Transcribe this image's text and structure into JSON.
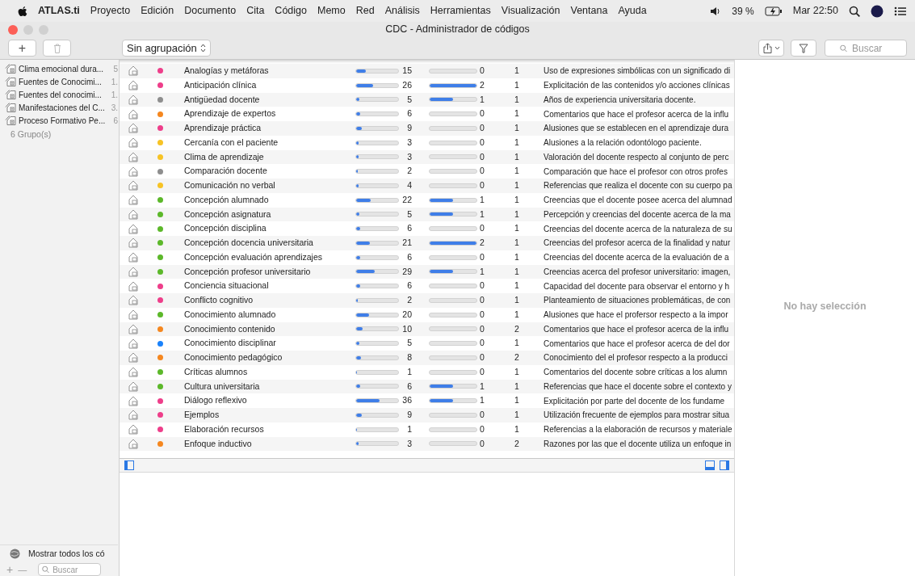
{
  "menubar": {
    "app": "ATLAS.ti",
    "menus": [
      "Proyecto",
      "Edición",
      "Documento",
      "Cita",
      "Código",
      "Memo",
      "Red",
      "Análisis",
      "Herramientas",
      "Visualización",
      "Ventana",
      "Ayuda"
    ],
    "battery": "39 %",
    "clock": "Mar 22:50"
  },
  "window": {
    "title": "CDC - Administrador de códigos"
  },
  "toolbar": {
    "add": "+",
    "grouping": "Sin agrupación",
    "search": {
      "placeholder": "Buscar"
    }
  },
  "sidebar": {
    "groups": [
      {
        "name": "Clima emocional dura...",
        "count": "5"
      },
      {
        "name": "Fuentes de Conocimi...",
        "count": "1."
      },
      {
        "name": "Fuentes del conocimi...",
        "count": "1."
      },
      {
        "name": "Manifestaciones del C...",
        "count": "3."
      },
      {
        "name": "Proceso Formativo Pe...",
        "count": "6"
      }
    ],
    "summary": "6 Grupo(s)",
    "show_all": "Mostrar todos los có",
    "add": "+",
    "remove": "—",
    "search": {
      "placeholder": "Buscar"
    }
  },
  "table": {
    "rows": [
      {
        "name": "Analogías y metáforas",
        "color": "#ee3e8a",
        "quotations": {
          "count": "15",
          "level": 0.23
        },
        "links": {
          "count": "0",
          "level": 0
        },
        "column_3": "1",
        "comment": "Uso de expresiones simbólicas con un significado di"
      },
      {
        "name": "Anticipación clínica",
        "color": "#ee3e8a",
        "quotations": {
          "count": "26",
          "level": 0.4
        },
        "links": {
          "count": "2",
          "level": 1
        },
        "column_3": "1",
        "comment": "Explicitación de las contenidos y/o acciones clínicas"
      },
      {
        "name": "Antigüedad docente",
        "color": "#8e8e8e",
        "quotations": {
          "count": "5",
          "level": 0.08
        },
        "links": {
          "count": "1",
          "level": 0.5
        },
        "column_3": "1",
        "comment": "Años de experiencia universitaria docente."
      },
      {
        "name": "Aprendizaje de expertos",
        "color": "#f5871f",
        "quotations": {
          "count": "6",
          "level": 0.09
        },
        "links": {
          "count": "0",
          "level": 0
        },
        "column_3": "1",
        "comment": "Comentarios que hace el profesor acerca  de la influ"
      },
      {
        "name": "Aprendizaje práctica",
        "color": "#ee3e8a",
        "quotations": {
          "count": "9",
          "level": 0.14
        },
        "links": {
          "count": "0",
          "level": 0
        },
        "column_3": "1",
        "comment": "Alusiones que se establecen en el aprendizaje dura"
      },
      {
        "name": "Cercanía con el paciente",
        "color": "#f7c325",
        "quotations": {
          "count": "3",
          "level": 0.05
        },
        "links": {
          "count": "0",
          "level": 0
        },
        "column_3": "1",
        "comment": "Alusiones a la relación odontólogo paciente."
      },
      {
        "name": "Clima de aprendizaje",
        "color": "#f7c325",
        "quotations": {
          "count": "3",
          "level": 0.05
        },
        "links": {
          "count": "0",
          "level": 0
        },
        "column_3": "1",
        "comment": "Valoración del docente respecto al conjunto de perc"
      },
      {
        "name": "Comparación docente",
        "color": "#8e8e8e",
        "quotations": {
          "count": "2",
          "level": 0.03
        },
        "links": {
          "count": "0",
          "level": 0
        },
        "column_3": "1",
        "comment": "Comparación que hace el profesor con otros profes"
      },
      {
        "name": "Comunicación no verbal",
        "color": "#f7c325",
        "quotations": {
          "count": "4",
          "level": 0.06
        },
        "links": {
          "count": "0",
          "level": 0
        },
        "column_3": "1",
        "comment": "Referencias que realiza el docente con su cuerpo pa"
      },
      {
        "name": "Concepción alumnado",
        "color": "#5cb82a",
        "quotations": {
          "count": "22",
          "level": 0.34
        },
        "links": {
          "count": "1",
          "level": 0.5
        },
        "column_3": "1",
        "comment": "Creencias que el docente posee acerca del alumnad"
      },
      {
        "name": "Concepción asignatura",
        "color": "#5cb82a",
        "quotations": {
          "count": "5",
          "level": 0.08
        },
        "links": {
          "count": "1",
          "level": 0.5
        },
        "column_3": "1",
        "comment": "Percepción y creencias del docente acerca de la ma"
      },
      {
        "name": "Concepción disciplina",
        "color": "#5cb82a",
        "quotations": {
          "count": "6",
          "level": 0.09
        },
        "links": {
          "count": "0",
          "level": 0
        },
        "column_3": "1",
        "comment": "Creencias del docente acerca de la naturaleza de su"
      },
      {
        "name": "Concepción docencia universitaria",
        "color": "#5cb82a",
        "quotations": {
          "count": "21",
          "level": 0.32
        },
        "links": {
          "count": "2",
          "level": 1
        },
        "column_3": "1",
        "comment": "Creencias del profesor acerca de la finalidad y natur"
      },
      {
        "name": "Concepción evaluación aprendizajes",
        "color": "#5cb82a",
        "quotations": {
          "count": "6",
          "level": 0.09
        },
        "links": {
          "count": "0",
          "level": 0
        },
        "column_3": "1",
        "comment": "Creencias del docente acerca de la evaluación de a"
      },
      {
        "name": "Concepción profesor universitario",
        "color": "#5cb82a",
        "quotations": {
          "count": "29",
          "level": 0.45
        },
        "links": {
          "count": "1",
          "level": 0.5
        },
        "column_3": "1",
        "comment": "Creencias acerca del profesor universitario: imagen,"
      },
      {
        "name": "Conciencia situacional",
        "color": "#ee3e8a",
        "quotations": {
          "count": "6",
          "level": 0.09
        },
        "links": {
          "count": "0",
          "level": 0
        },
        "column_3": "1",
        "comment": "Capacidad del docente para observar el entorno y h"
      },
      {
        "name": "Conflicto cognitivo",
        "color": "#ee3e8a",
        "quotations": {
          "count": "2",
          "level": 0.03
        },
        "links": {
          "count": "0",
          "level": 0
        },
        "column_3": "1",
        "comment": "Planteamiento de situaciones problemáticas, de con"
      },
      {
        "name": "Conocimiento alumnado",
        "color": "#5cb82a",
        "quotations": {
          "count": "20",
          "level": 0.3
        },
        "links": {
          "count": "0",
          "level": 0
        },
        "column_3": "1",
        "comment": "Alusiones que hace el profersor respecto a la impor"
      },
      {
        "name": "Conocimiento contenido",
        "color": "#f5871f",
        "quotations": {
          "count": "10",
          "level": 0.15
        },
        "links": {
          "count": "0",
          "level": 0
        },
        "column_3": "2",
        "comment": "Comentarios que hace el profesor acerca de la influ"
      },
      {
        "name": "Conocimiento disciplinar",
        "color": "#1a82fb",
        "quotations": {
          "count": "5",
          "level": 0.08
        },
        "links": {
          "count": "0",
          "level": 0
        },
        "column_3": "1",
        "comment": "Comentarios que hace el profesor acerca de del dor"
      },
      {
        "name": "Conocimiento pedagógico",
        "color": "#f5871f",
        "quotations": {
          "count": "8",
          "level": 0.12
        },
        "links": {
          "count": "0",
          "level": 0
        },
        "column_3": "2",
        "comment": "Conocimiento del el profesor respecto a la producci"
      },
      {
        "name": "Críticas alumnos",
        "color": "#5cb82a",
        "quotations": {
          "count": "1",
          "level": 0.01
        },
        "links": {
          "count": "0",
          "level": 0
        },
        "column_3": "1",
        "comment": "Comentarios del docente sobre críticas a los alumn"
      },
      {
        "name": "Cultura universitaria",
        "color": "#5cb82a",
        "quotations": {
          "count": "6",
          "level": 0.09
        },
        "links": {
          "count": "1",
          "level": 0.5
        },
        "column_3": "1",
        "comment": "Referencias que hace el docente sobre el contexto y"
      },
      {
        "name": "Diálogo reflexivo",
        "color": "#ee3e8a",
        "quotations": {
          "count": "36",
          "level": 0.55
        },
        "links": {
          "count": "1",
          "level": 0.5
        },
        "column_3": "1",
        "comment": "Explicitación por parte del docente de los  fundame"
      },
      {
        "name": "Ejemplos",
        "color": "#ee3e8a",
        "quotations": {
          "count": "9",
          "level": 0.14
        },
        "links": {
          "count": "0",
          "level": 0
        },
        "column_3": "1",
        "comment": "Utilización frecuente de ejemplos para mostrar situa"
      },
      {
        "name": "Elaboración recursos",
        "color": "#ee3e8a",
        "quotations": {
          "count": "1",
          "level": 0.01
        },
        "links": {
          "count": "0",
          "level": 0
        },
        "column_3": "1",
        "comment": "Referencias a la elaboración de recursos y materiale"
      },
      {
        "name": "Enfoque inductivo",
        "color": "#f5871f",
        "quotations": {
          "count": "3",
          "level": 0.05
        },
        "links": {
          "count": "0",
          "level": 0
        },
        "column_3": "2",
        "comment": "Razones por las que el docente utiliza un enfoque in"
      }
    ]
  },
  "detail": {
    "empty": "No hay selección"
  }
}
